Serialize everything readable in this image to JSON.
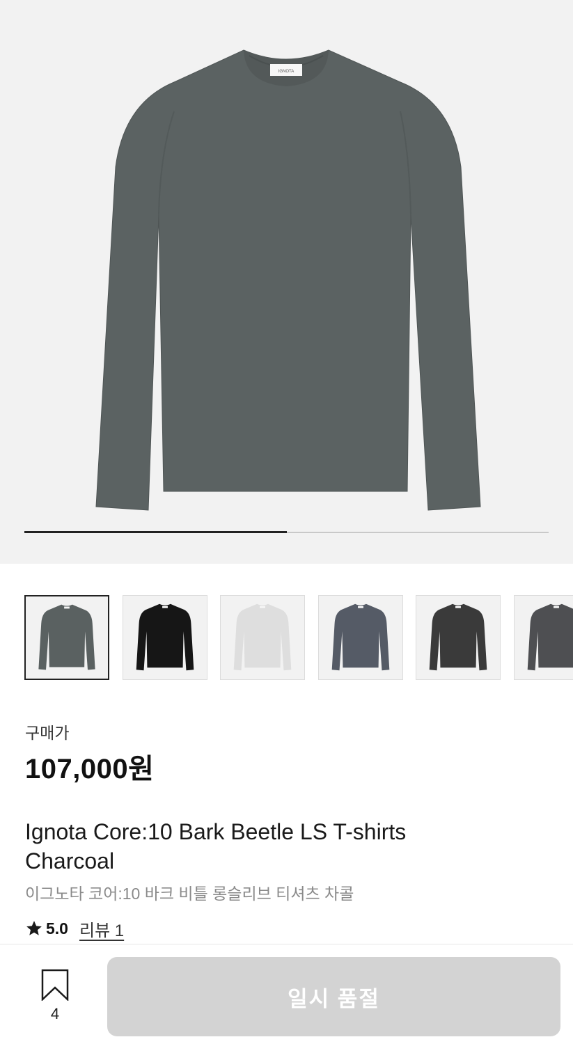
{
  "gallery": {
    "image_count": 2,
    "current_index": 1,
    "progress_fraction": 0.5,
    "main_image_color": "#5b6262",
    "neck_label_text": "IGNOTA"
  },
  "thumbnails": [
    {
      "name": "charcoal",
      "color": "#5a6161",
      "selected": true
    },
    {
      "name": "black",
      "color": "#161616",
      "selected": false
    },
    {
      "name": "light-grey",
      "color": "#dedede",
      "selected": false
    },
    {
      "name": "slate",
      "color": "#555b66",
      "selected": false
    },
    {
      "name": "dark-grey",
      "color": "#3a3a3a",
      "selected": false
    },
    {
      "name": "graphite",
      "color": "#4e4f52",
      "selected": false
    }
  ],
  "price": {
    "label": "구매가",
    "value": "107,000원"
  },
  "product": {
    "name_en": "Ignota Core:10 Bark Beetle LS T-shirts Charcoal",
    "name_ko": "이그노타 코어:10 바크 비틀 롱슬리브 티셔츠 차콜"
  },
  "rating": {
    "score": "5.0",
    "review_link": "리뷰 1",
    "icon": "star-icon"
  },
  "bottom_bar": {
    "bookmark_icon": "bookmark-icon",
    "bookmark_count": "4",
    "cta_label": "일시 품절",
    "cta_color": "#d3d3d3"
  }
}
